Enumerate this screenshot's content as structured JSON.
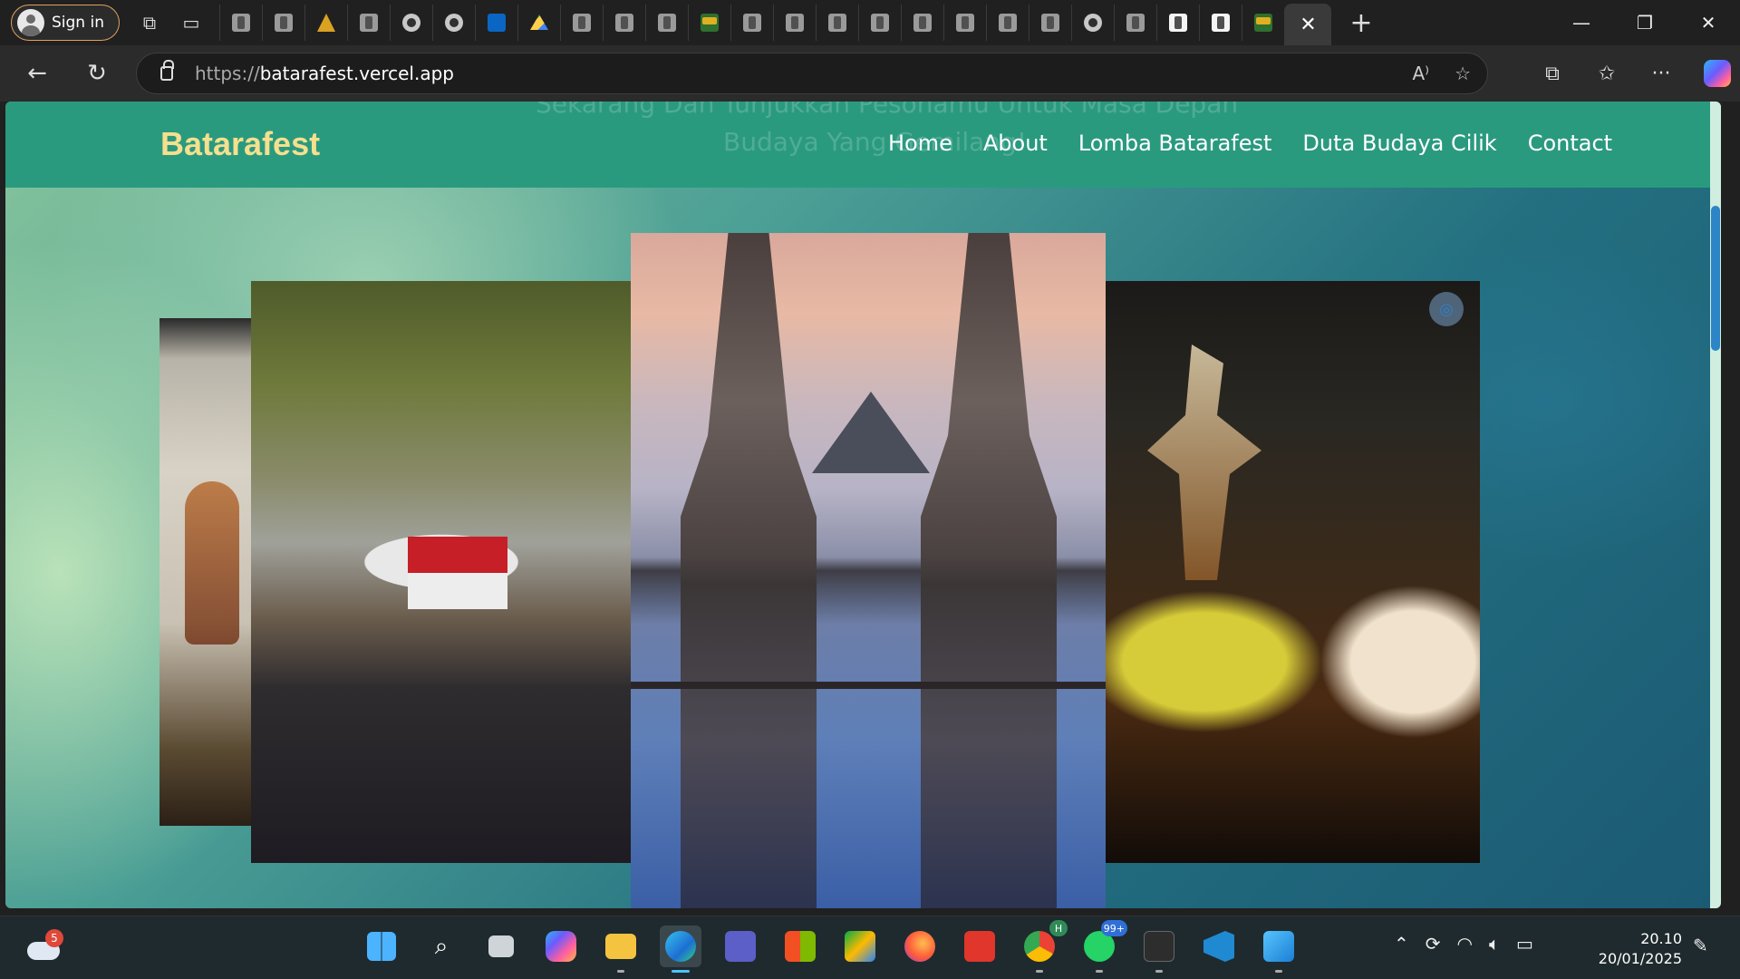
{
  "browser": {
    "sign_in_label": "Sign in",
    "url_prefix": "https://",
    "url_domain": "batarafest.vercel.app",
    "active_tab_close": "✕",
    "new_tab": "+",
    "tab_icons": [
      "generic",
      "generic",
      "sun",
      "generic",
      "github",
      "github",
      "linkedin",
      "drive",
      "generic",
      "copy",
      "generic",
      "cap",
      "generic",
      "calendar",
      "generic",
      "generic",
      "generic",
      "generic",
      "generic",
      "generic",
      "generic",
      "github",
      "generic",
      "white",
      "white",
      "cap"
    ],
    "window_controls": {
      "minimize": "—",
      "restore": "❐",
      "close": "✕"
    },
    "read_aloud": "A⁾",
    "favorite_icon": "☆",
    "extensions_icon": "⧉",
    "favorites_icon": "✩",
    "more_icon": "···"
  },
  "site": {
    "brand": "Batarafest",
    "nav": [
      "Home",
      "About",
      "Lomba Batarafest",
      "Duta Budaya Cilik",
      "Contact"
    ],
    "ghost_line_1": "Sekarang Dan Tunjukkan Pesonamu Untuk Masa Depan",
    "ghost_line_2": "Budaya Yang Gemilang!"
  },
  "gallery": {
    "items": [
      "wayang-kulit",
      "festival-crowd",
      "bali-temple-gate",
      "child-dalang"
    ]
  },
  "taskbar": {
    "weather_badge": "5",
    "whatsapp_badge": "99+",
    "chrome_badge": "H",
    "time": "20.10",
    "date": "20/01/2025"
  },
  "colors": {
    "navbar": "#2a9a7f",
    "brand": "#f6df8e",
    "nav_text": "#ffffff"
  }
}
